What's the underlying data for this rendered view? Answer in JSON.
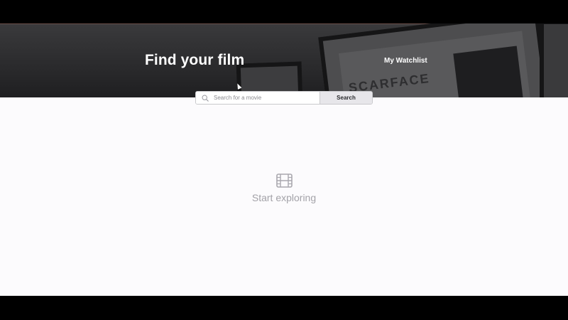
{
  "hero": {
    "title": "Find your film",
    "watchlist_label": "My Watchlist",
    "poster_word": "SCARFACE"
  },
  "search": {
    "placeholder": "Search for a movie",
    "value": "",
    "button_label": "Search",
    "icon": "search-icon"
  },
  "empty_state": {
    "icon": "film-icon",
    "text": "Start exploring"
  },
  "colors": {
    "page_background": "#fcfbfd",
    "hero_background": "#2e2e30",
    "empty_text": "#a3a2a8",
    "button_background": "#e7e6ea"
  }
}
